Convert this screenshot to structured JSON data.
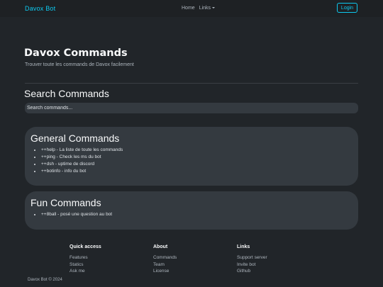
{
  "navbar": {
    "brand": "Davox Bot",
    "home": "Home",
    "links": "Links",
    "login": "Login"
  },
  "hero": {
    "title": "Davox Commands",
    "subtitle": "Trouver toute les commands de Davox facilement"
  },
  "search": {
    "title": "Search Commands",
    "placeholder": "Search commands..."
  },
  "general": {
    "title": "General Commands",
    "items": [
      "++help - La liste de toute les commands",
      "++ping - Check les ms du bot",
      "++dsh - uptime de discord",
      "++botinfo - info du bot"
    ]
  },
  "fun": {
    "title": "Fun Commands",
    "items": [
      "++8ball - posé une question au bot"
    ]
  },
  "footer": {
    "quick": {
      "title": "Quick access",
      "items": [
        "Features",
        "Statics",
        "Ask me"
      ]
    },
    "about": {
      "title": "About",
      "items": [
        "Commands",
        "Team",
        "License"
      ]
    },
    "links": {
      "title": "Links",
      "items": [
        "Support server",
        "Invite bot",
        "Github"
      ]
    },
    "copyright": "Davox Bot © 2024"
  },
  "colors": {
    "background": "#212529",
    "accent": "#0dcaf0",
    "card": "#343a40"
  }
}
